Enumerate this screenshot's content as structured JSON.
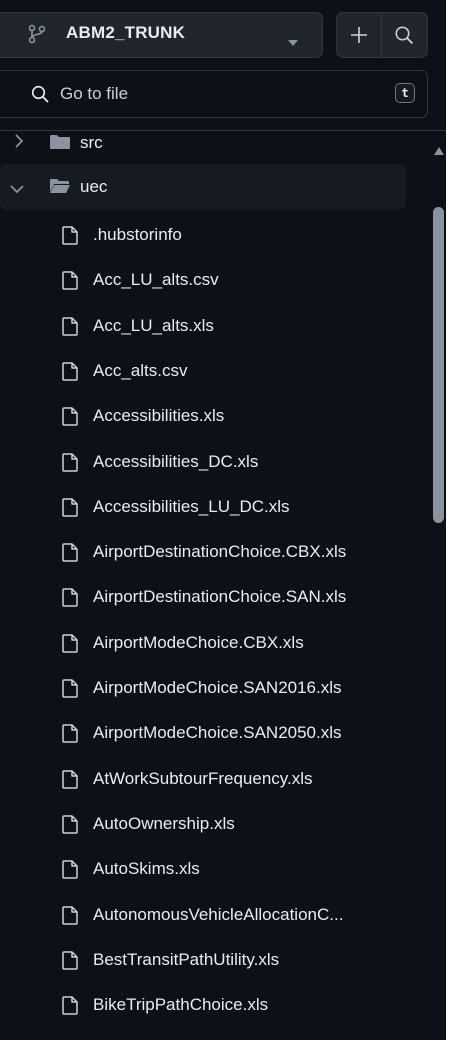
{
  "header": {
    "branch_name": "ABM2_TRUNK",
    "goto_placeholder": "Go to file",
    "shortcut_key": "t"
  },
  "tree": {
    "folders": [
      {
        "name": "src",
        "expanded": false
      },
      {
        "name": "uec",
        "expanded": true
      }
    ],
    "files": [
      ".hubstorinfo",
      "Acc_LU_alts.csv",
      "Acc_LU_alts.xls",
      "Acc_alts.csv",
      "Accessibilities.xls",
      "Accessibilities_DC.xls",
      "Accessibilities_LU_DC.xls",
      "AirportDestinationChoice.CBX.xls",
      "AirportDestinationChoice.SAN.xls",
      "AirportModeChoice.CBX.xls",
      "AirportModeChoice.SAN2016.xls",
      "AirportModeChoice.SAN2050.xls",
      "AtWorkSubtourFrequency.xls",
      "AutoOwnership.xls",
      "AutoSkims.xls",
      "AutonomousVehicleAllocationC...",
      "BestTransitPathUtility.xls",
      "BikeTripPathChoice.xls"
    ]
  },
  "icons": {
    "branch": "git-branch-icon",
    "caret": "caret-down-icon",
    "plus": "plus-icon",
    "search": "search-icon",
    "file": "file-icon",
    "folder": "folder-icon",
    "chevron_right": "chevron-right-icon",
    "chevron_down": "chevron-down-icon"
  },
  "colors": {
    "background": "#0d1117",
    "surface": "#21262d",
    "border": "#30363d",
    "text": "#e6edf3",
    "muted_icon": "#8b949e",
    "selected_row": "#161b22"
  }
}
